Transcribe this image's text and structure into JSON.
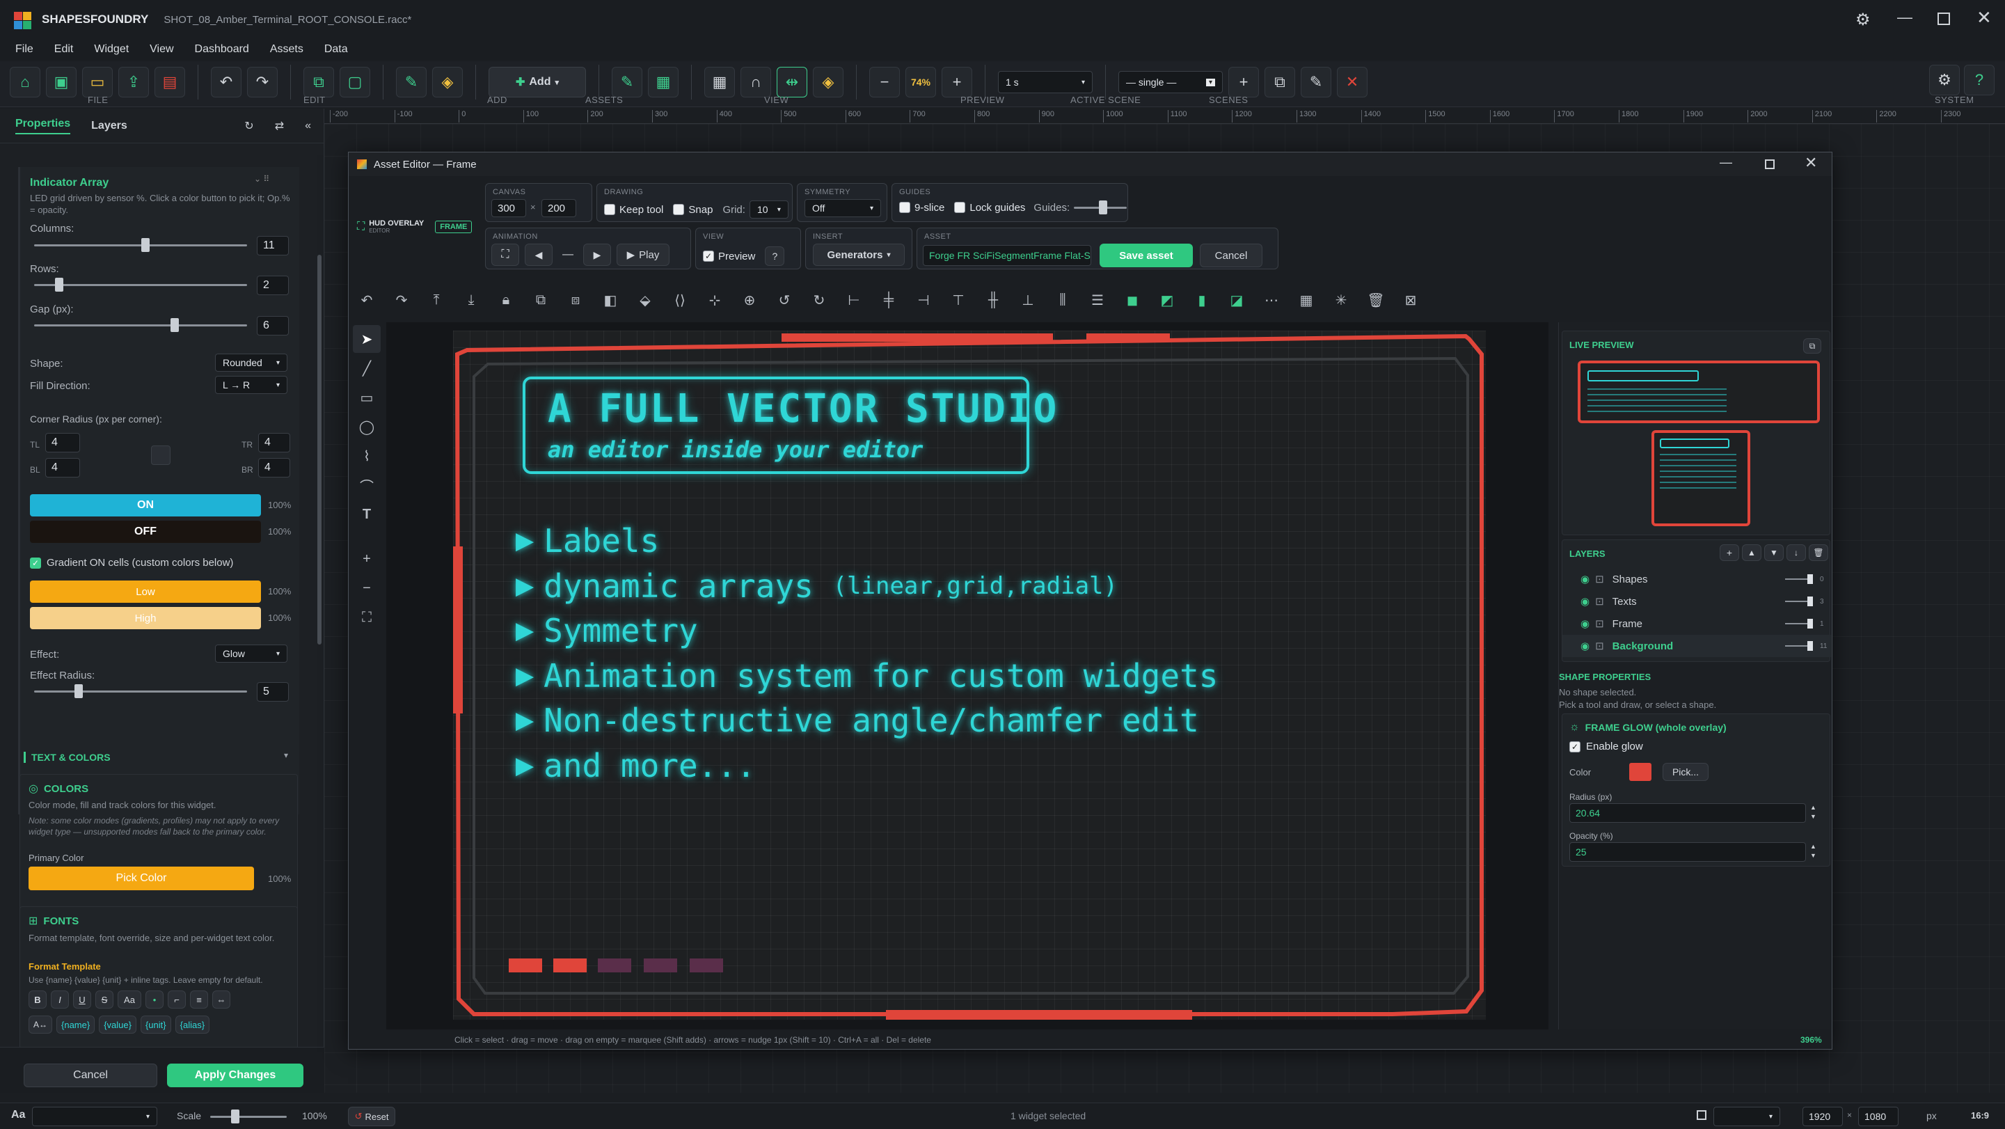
{
  "app": {
    "brand": "SHAPESFOUNDRY",
    "title": "SHOT_08_Amber_Terminal_ROOT_CONSOLE.racc*"
  },
  "menu": [
    "File",
    "Edit",
    "Widget",
    "View",
    "Dashboard",
    "Assets",
    "Data"
  ],
  "toolbar": {
    "groups": {
      "file": "FILE",
      "edit": "EDIT",
      "add": "ADD",
      "assets": "ASSETS",
      "view": "VIEW",
      "preview": "PREVIEW",
      "active_scene": "ACTIVE SCENE",
      "scenes": "SCENES",
      "system": "SYSTEM"
    },
    "add_label": "Add",
    "zoom": "74%",
    "preview_value": "1 s",
    "scene_value": "— single —"
  },
  "ruler": {
    "ticks": [
      "-200",
      "-100",
      "0",
      "100",
      "200",
      "300",
      "400",
      "500",
      "600",
      "700",
      "800",
      "900",
      "1000",
      "1100",
      "1200",
      "1300",
      "1400",
      "1500",
      "1600",
      "1700",
      "1800",
      "1900",
      "2000",
      "2100",
      "2200",
      "2300"
    ]
  },
  "left_panel": {
    "tabs": [
      "Properties",
      "Layers"
    ],
    "indicator": {
      "title": "Indicator Array",
      "desc": "LED grid driven by sensor %. Click a color button to pick it; Op.% = opacity.",
      "columns_label": "Columns:",
      "columns": "11",
      "rows_label": "Rows:",
      "rows": "2",
      "gap_label": "Gap (px):",
      "gap": "6",
      "shape_label": "Shape:",
      "shape": "Rounded",
      "fill_label": "Fill Direction:",
      "fill": "L → R",
      "corner_label": "Corner Radius (px per corner):",
      "tl_label": "TL",
      "tl": "4",
      "tr_label": "TR",
      "tr": "4",
      "bl_label": "BL",
      "bl": "4",
      "br_label": "BR",
      "br": "4",
      "on_label": "ON",
      "on_pct": "100%",
      "off_label": "OFF",
      "off_pct": "100%",
      "gradient_label": "Gradient ON cells (custom colors below)",
      "low_label": "Low",
      "low_pct": "100%",
      "high_label": "High",
      "high_pct": "100%",
      "effect_label": "Effect:",
      "effect": "Glow",
      "effect_radius_label": "Effect Radius:",
      "effect_radius": "5"
    },
    "text_colors": {
      "section": "TEXT & COLORS",
      "colors_title": "COLORS",
      "colors_desc": "Color mode, fill and track colors for this widget.",
      "colors_note": "Note: some color modes (gradients, profiles) may not apply to every widget type — unsupported modes fall back to the primary color.",
      "primary_label": "Primary Color",
      "pick_label": "Pick Color",
      "pick_pct": "100%"
    },
    "fonts": {
      "title": "FONTS",
      "desc": "Format template, font override, size and per-widget text color.",
      "format_title": "Format Template",
      "format_desc": "Use {name} {value} {unit} + inline tags. Leave empty for default.",
      "fmt_buttons": [
        "B",
        "I",
        "U",
        "S",
        "Aa",
        "•",
        "⌐",
        "≡",
        "⇔"
      ],
      "tags": [
        "{name}",
        "{value}",
        "{unit}",
        "{alias}"
      ],
      "a_label": "A↔"
    },
    "cancel": "Cancel",
    "apply": "Apply Changes"
  },
  "editor": {
    "title": "Asset Editor — Frame",
    "hud_label": "HUD OVERLAY",
    "hud_sub": "EDITOR",
    "frame_badge": "FRAME",
    "canvas_group": "CANVAS",
    "canvas_w": "300",
    "canvas_x": "×",
    "canvas_h": "200",
    "drawing_group": "DRAWING",
    "keep_tool": "Keep tool",
    "snap": "Snap",
    "grid_label": "Grid:",
    "grid": "10",
    "symmetry_group": "SYMMETRY",
    "symmetry": "Off",
    "guides_group": "GUIDES",
    "nine_slice": "9-slice",
    "lock_guides": "Lock guides",
    "guides_label": "Guides:",
    "animation_group": "ANIMATION",
    "play": "Play",
    "view_group": "VIEW",
    "preview": "Preview",
    "help": "?",
    "insert_group": "INSERT",
    "generators": "Generators",
    "asset_group": "ASSET",
    "asset_name": "Forge FR SciFiSegmentFrame Flat-S",
    "save": "Save asset",
    "cancel": "Cancel",
    "status": "Click = select · drag = move · drag on empty = marquee (Shift adds) · arrows = nudge 1px (Shift = 10) · Ctrl+A = all · Del = delete",
    "zoom": "396%"
  },
  "canvas": {
    "headline": "A FULL VECTOR STUDIO",
    "subline": "an editor inside your editor",
    "bullets": [
      {
        "text": "Labels",
        "extra": ""
      },
      {
        "text": "dynamic arrays ",
        "extra": "(linear,grid,radial)"
      },
      {
        "text": "Symmetry",
        "extra": ""
      },
      {
        "text": "Animation system for custom widgets",
        "extra": ""
      },
      {
        "text": "Non-destructive angle/chamfer edit",
        "extra": ""
      },
      {
        "text": "and more...",
        "extra": ""
      }
    ],
    "colors": {
      "frame": "#e0453a",
      "text": "#2fd6d6",
      "bg": "#1e2022"
    }
  },
  "right_panel": {
    "live_preview": "LIVE PREVIEW",
    "layers_title": "LAYERS",
    "layers": [
      {
        "name": "Shapes",
        "count": "0"
      },
      {
        "name": "Texts",
        "count": "3"
      },
      {
        "name": "Frame",
        "count": "1"
      },
      {
        "name": "Background",
        "count": "11"
      }
    ],
    "shape_props": "SHAPE PROPERTIES",
    "no_shape": "No shape selected.",
    "no_shape_hint": "Pick a tool and draw, or select a shape.",
    "frame_glow": "FRAME GLOW (whole overlay)",
    "enable_glow": "Enable glow",
    "color_label": "Color",
    "pick": "Pick...",
    "radius_label": "Radius (px)",
    "radius": "20.64",
    "opacity_label": "Opacity (%)",
    "opacity": "25"
  },
  "statusbar": {
    "aa": "Aa",
    "scale_label": "Scale",
    "scale": "100%",
    "reset": "Reset",
    "selected": "1 widget selected",
    "w": "1920",
    "h": "1080",
    "unit": "px",
    "ratio": "16:9"
  }
}
